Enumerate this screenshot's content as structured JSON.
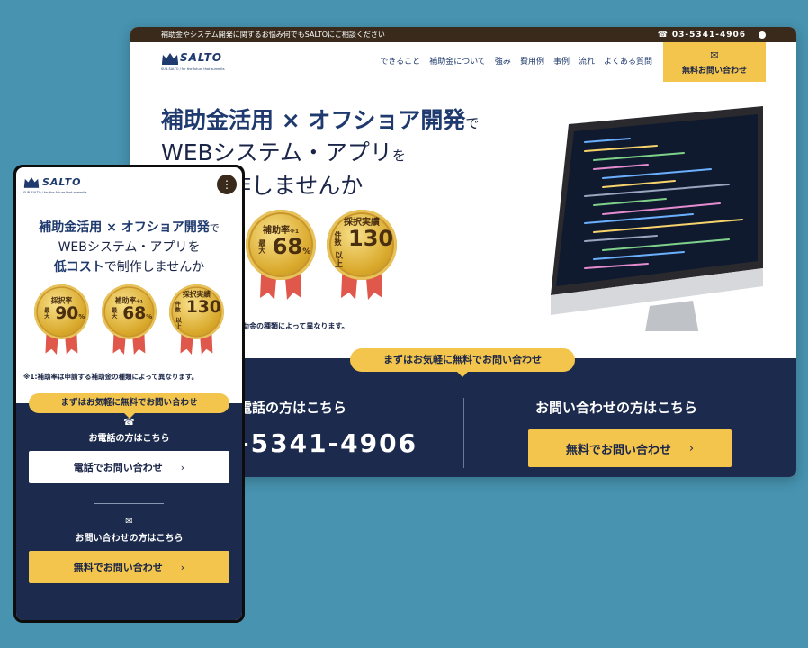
{
  "desktop": {
    "topbar": {
      "message": "補助金やシステム開発に関するお悩み何でもSALTOにご相談ください",
      "phone_icon": "☎",
      "phone": "03-5341-4906"
    },
    "logo": {
      "brand": "SALTO",
      "tagline": "SUB-SALTO / for the future that summits"
    },
    "nav": [
      "できること",
      "補助金について",
      "強み",
      "費用例",
      "事例",
      "流れ",
      "よくある質問"
    ],
    "cta": {
      "icon": "✉",
      "label": "無料お問い合わせ"
    },
    "hero": {
      "line1_bold": "補助金活用 × オフショア開発",
      "line1_tail": "で",
      "line2": "WEBシステム・アプリ",
      "line2_tail": "を",
      "line3_bold": "ト",
      "line3_tail": "で制作しませんか"
    },
    "medals": [
      {
        "label": "補助率",
        "sup": "※1",
        "prefix": "最大",
        "value": "68",
        "unit": "%"
      },
      {
        "label": "採択実績",
        "prefix": "件数",
        "value": "130",
        "unit": "以上"
      }
    ],
    "note": "助金の種類によって異なります。",
    "contact_pill": "まずはお気軽に無料でお問い合わせ",
    "phone_heading": "電話の方はこちら",
    "phone_number": "-5341-4906",
    "form_heading": "お問い合わせの方はこちら",
    "form_button": "無料でお問い合わせ"
  },
  "mobile": {
    "logo": {
      "brand": "SALTO",
      "tagline": "SUB-SALTO / for the future that summits"
    },
    "menu_icon": "⋮",
    "hero": {
      "line1_bold": "補助金活用 × オフショア開発",
      "line1_tail": "で",
      "line2": "WEBシステム・アプリを",
      "line3_bold": "低コスト",
      "line3_tail": "で制作しませんか"
    },
    "medals": [
      {
        "label": "採択率",
        "prefix": "最大",
        "value": "90",
        "unit": "%"
      },
      {
        "label": "補助率",
        "sup": "※1",
        "prefix": "最大",
        "value": "68",
        "unit": "%"
      },
      {
        "label": "採択実績",
        "prefix": "件数",
        "value": "130",
        "unit": "以上"
      }
    ],
    "note": "※1:補助率は申請する補助金の種類によって異なります。",
    "contact_pill": "まずはお気軽に無料でお問い合わせ",
    "phone_icon": "☎",
    "phone_heading": "お電話の方はこちら",
    "phone_button": "電話でお問い合わせ",
    "mail_icon": "✉",
    "form_heading": "お問い合わせの方はこちら",
    "form_button": "無料でお問い合わせ"
  },
  "colors": {
    "navy": "#1c2b4d",
    "gold": "#f3c54d",
    "background": "#4793b0",
    "topbar": "#3a2a1c"
  }
}
